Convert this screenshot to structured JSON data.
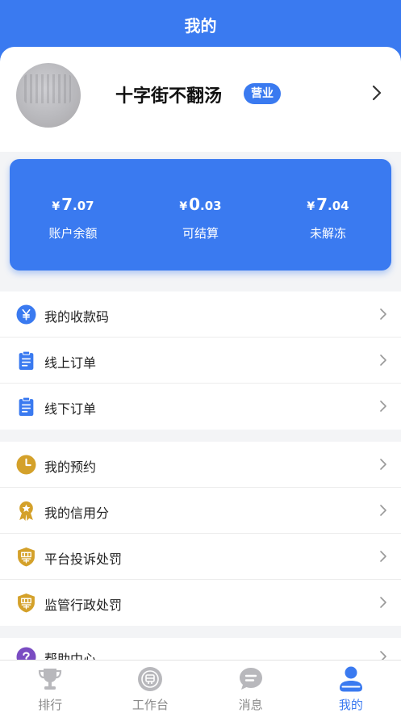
{
  "header": {
    "title": "我的"
  },
  "profile": {
    "shop_name": "十字街不翻汤",
    "status": "营业"
  },
  "balances": [
    {
      "currency": "¥",
      "int": "7",
      "dec": ".07",
      "label": "账户余额"
    },
    {
      "currency": "¥",
      "int": "0",
      "dec": ".03",
      "label": "可结算"
    },
    {
      "currency": "¥",
      "int": "7",
      "dec": ".04",
      "label": "未解冻"
    }
  ],
  "menu_groups": [
    [
      {
        "label": "我的收款码",
        "icon": "yuan-coin-icon",
        "color": "#3a7af0"
      },
      {
        "label": "线上订单",
        "icon": "clipboard-icon",
        "color": "#3a7af0"
      },
      {
        "label": "线下订单",
        "icon": "clipboard-icon",
        "color": "#3a7af0"
      }
    ],
    [
      {
        "label": "我的预约",
        "icon": "clock-icon",
        "color": "#d4a12a"
      },
      {
        "label": "我的信用分",
        "icon": "award-badge-icon",
        "color": "#d4a12a"
      },
      {
        "label": "平台投诉处罚",
        "icon": "shield-penalty-icon",
        "color": "#d4a12a"
      },
      {
        "label": "监管行政处罚",
        "icon": "shield-penalty-icon",
        "color": "#d4a12a"
      }
    ],
    [
      {
        "label": "帮助中心",
        "icon": "help-icon",
        "color": "#7a4cc2"
      }
    ]
  ],
  "tabs": [
    {
      "label": "排行",
      "icon": "trophy-icon",
      "active": false
    },
    {
      "label": "工作台",
      "icon": "workbench-icon",
      "active": false
    },
    {
      "label": "消息",
      "icon": "message-icon",
      "active": false
    },
    {
      "label": "我的",
      "icon": "user-icon",
      "active": true
    }
  ],
  "colors": {
    "primary": "#3a7af0",
    "gold": "#d4a12a",
    "purple": "#7a4cc2",
    "inactive": "#b8b8bc"
  }
}
